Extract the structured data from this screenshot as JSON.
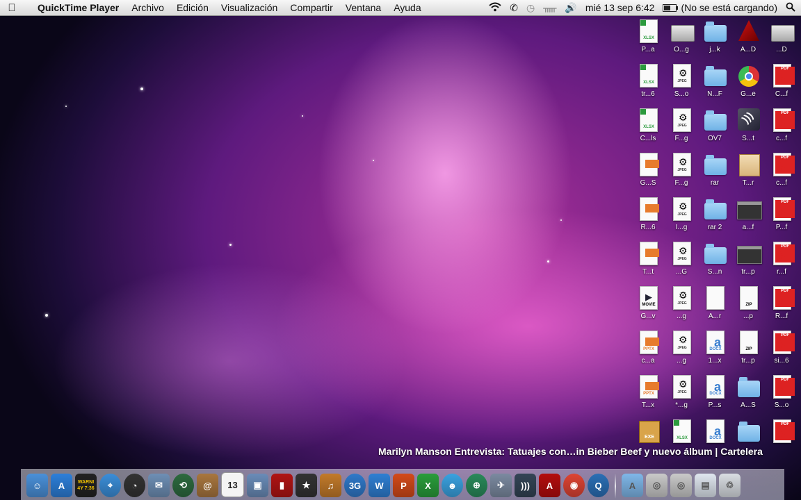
{
  "menubar": {
    "app_name": "QuickTime Player",
    "menus": [
      "Archivo",
      "Edición",
      "Visualización",
      "Compartir",
      "Ventana",
      "Ayuda"
    ],
    "clock": "mié 13 sep  6:42",
    "battery_status": "(No se está cargando)",
    "battery_level": 0.55,
    "status_icons": [
      "wifi-icon",
      "phone-icon",
      "time-machine-icon",
      "bluetooth-icon",
      "volume-icon",
      "battery-icon",
      "spotlight-icon"
    ]
  },
  "desktop_icons": [
    {
      "label": "P...a",
      "kind": "xlsx"
    },
    {
      "label": "O...g",
      "kind": "drive"
    },
    {
      "label": "j...k",
      "kind": "folder"
    },
    {
      "label": "A...D",
      "kind": "autocad"
    },
    {
      "label": "...D",
      "kind": "drive"
    },
    {
      "label": "tr...6",
      "kind": "xlsx"
    },
    {
      "label": "S...o",
      "kind": "jpeg"
    },
    {
      "label": "N...F",
      "kind": "folder"
    },
    {
      "label": "G...e",
      "kind": "chrome"
    },
    {
      "label": "C...f",
      "kind": "pdf"
    },
    {
      "label": "C...ls",
      "kind": "xlsx"
    },
    {
      "label": "F...g",
      "kind": "jpeg"
    },
    {
      "label": "OV7",
      "kind": "folder"
    },
    {
      "label": "S...t",
      "kind": "wifi"
    },
    {
      "label": "c...f",
      "kind": "pdf"
    },
    {
      "label": "G...S",
      "kind": "ppt"
    },
    {
      "label": "F...g",
      "kind": "jpeg"
    },
    {
      "label": "rar",
      "kind": "folder"
    },
    {
      "label": "T...r",
      "kind": "archive"
    },
    {
      "label": "c...f",
      "kind": "pdf"
    },
    {
      "label": "R...6",
      "kind": "ppt"
    },
    {
      "label": "I...g",
      "kind": "jpeg"
    },
    {
      "label": "rar 2",
      "kind": "folder"
    },
    {
      "label": "a...f",
      "kind": "terminal"
    },
    {
      "label": "P...f",
      "kind": "pdf"
    },
    {
      "label": "T...t",
      "kind": "ppt"
    },
    {
      "label": "...G",
      "kind": "jpeg"
    },
    {
      "label": "S...n",
      "kind": "folder"
    },
    {
      "label": "tr...p",
      "kind": "terminal"
    },
    {
      "label": "r...f",
      "kind": "pdf"
    },
    {
      "label": "G...v",
      "kind": "movie"
    },
    {
      "label": "...g",
      "kind": "jpeg"
    },
    {
      "label": "A...r",
      "kind": "blank"
    },
    {
      "label": "...p",
      "kind": "zip"
    },
    {
      "label": "R...f",
      "kind": "pdf"
    },
    {
      "label": "c...a",
      "kind": "pptx"
    },
    {
      "label": "...g",
      "kind": "jpeg"
    },
    {
      "label": "1...x",
      "kind": "docx"
    },
    {
      "label": "tr...p",
      "kind": "zip"
    },
    {
      "label": "si...6",
      "kind": "pdf"
    },
    {
      "label": "T...x",
      "kind": "pptx"
    },
    {
      "label": "*...g",
      "kind": "jpeg"
    },
    {
      "label": "P...s",
      "kind": "docx"
    },
    {
      "label": "A...S",
      "kind": "folder"
    },
    {
      "label": "S...o",
      "kind": "pdf"
    },
    {
      "label": "",
      "kind": "exe"
    },
    {
      "label": "",
      "kind": "xlsx"
    },
    {
      "label": "",
      "kind": "docx"
    },
    {
      "label": "",
      "kind": "folder"
    },
    {
      "label": "",
      "kind": "pdf"
    }
  ],
  "badges": {
    "xlsx": "XLSX",
    "pdf": "PDF",
    "jpeg": "JPEG",
    "zip": "ZIP",
    "docx": "DOCX",
    "pptx": "PPTX",
    "exe": "EXE",
    "movie": "MOVIE"
  },
  "video_caption": "Marilyn Manson Entrevista: Tatuajes con…in Bieber Beef y nuevo álbum | Cartelera",
  "dock": {
    "calendar_day": "13",
    "widget_text_top": "WARNI",
    "widget_text_bottom": "4Y 7:36",
    "items": [
      {
        "name": "finder-icon",
        "color": "#4a90d9",
        "glyph": "☺"
      },
      {
        "name": "app-store-icon",
        "color": "#2d7fd9",
        "glyph": "A"
      },
      {
        "name": "console-icon",
        "color": "#222222",
        "glyph": ""
      },
      {
        "name": "safari-icon",
        "color": "#3b8ed8",
        "glyph": "⌖"
      },
      {
        "name": "dashboard-icon",
        "color": "#333333",
        "glyph": "◔"
      },
      {
        "name": "mail-icon",
        "color": "#6e8fb5",
        "glyph": "✉"
      },
      {
        "name": "time-machine-icon",
        "color": "#2d6a3f",
        "glyph": "⟲"
      },
      {
        "name": "address-book-icon",
        "color": "#a8763e",
        "glyph": "@"
      },
      {
        "name": "ical-icon",
        "color": "#f0f0f0",
        "glyph": ""
      },
      {
        "name": "iphoto-icon",
        "color": "#6a8cb8",
        "glyph": "▣"
      },
      {
        "name": "photo-booth-icon",
        "color": "#b01414",
        "glyph": "▮"
      },
      {
        "name": "imovie-icon",
        "color": "#333333",
        "glyph": "★"
      },
      {
        "name": "garageband-icon",
        "color": "#c27a2a",
        "glyph": "♫"
      },
      {
        "name": "3g-icon",
        "color": "#2f79c9",
        "glyph": "3G"
      },
      {
        "name": "word-icon",
        "color": "#2f7fd3",
        "glyph": "W"
      },
      {
        "name": "powerpoint-icon",
        "color": "#d34a1a",
        "glyph": "P"
      },
      {
        "name": "excel-icon",
        "color": "#2a9d3b",
        "glyph": "X"
      },
      {
        "name": "messenger-icon",
        "color": "#3aa2e0",
        "glyph": "☻"
      },
      {
        "name": "network-icon",
        "color": "#2a8a5a",
        "glyph": "⊕"
      },
      {
        "name": "satellite-icon",
        "color": "#7b8aa0",
        "glyph": "✈"
      },
      {
        "name": "wireless-icon",
        "color": "#334455",
        "glyph": ")))"
      },
      {
        "name": "autocad-icon",
        "color": "#b30d0d",
        "glyph": "A"
      },
      {
        "name": "chrome-icon",
        "color": "#dd4433",
        "glyph": "◉"
      },
      {
        "name": "quicktime-icon",
        "color": "#2b6fb5",
        "glyph": "Q"
      }
    ],
    "right_items": [
      {
        "name": "applications-folder-icon",
        "color": "#7fb7e8",
        "glyph": "A"
      },
      {
        "name": "disk-icon-1",
        "color": "#c9c9c9",
        "glyph": "◎"
      },
      {
        "name": "disk-icon-2",
        "color": "#c9c9c9",
        "glyph": "◎"
      },
      {
        "name": "downloads-stack-icon",
        "color": "#dfe6ef",
        "glyph": "▤"
      },
      {
        "name": "trash-icon",
        "color": "#d9dde2",
        "glyph": "♲"
      }
    ]
  }
}
